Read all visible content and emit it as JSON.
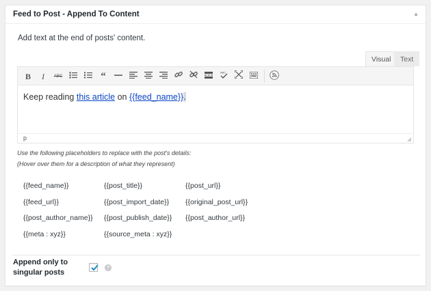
{
  "panel": {
    "title": "Feed to Post - Append To Content",
    "description": "Add text at the end of posts' content."
  },
  "editor": {
    "tabs": {
      "visual": "Visual",
      "text": "Text"
    },
    "toolbar_icons": [
      "bold-icon",
      "italic-icon",
      "strikethrough-icon",
      "bullet-list-icon",
      "numbered-list-icon",
      "blockquote-icon",
      "horizontal-rule-icon",
      "align-left-icon",
      "align-center-icon",
      "align-right-icon",
      "link-icon",
      "unlink-icon",
      "read-more-icon",
      "spellcheck-icon",
      "fullscreen-icon",
      "kitchen-sink-icon",
      "rss-icon"
    ],
    "content": {
      "prefix": "Keep reading ",
      "link1": "this article",
      "middle": " on ",
      "link2": "{{feed_name}}",
      "suffix": "."
    },
    "status_path": "p"
  },
  "help": {
    "line1": "Use the following placeholders to replace with the post's details:",
    "line2": "(Hover over them for a description of what they represent)"
  },
  "placeholders": [
    [
      "{{feed_name}}",
      "{{post_title}}",
      "{{post_url}}"
    ],
    [
      "{{feed_url}}",
      "{{post_import_date}}",
      "{{original_post_url}}"
    ],
    [
      "{{post_author_name}}",
      "{{post_publish_date}}",
      "{{post_author_url}}"
    ],
    [
      "{{meta : xyz}}",
      "{{source_meta : xyz}}",
      ""
    ]
  ],
  "option": {
    "label": "Append only to singular posts",
    "checked": true,
    "help_icon": "question-mark-icon"
  },
  "colors": {
    "link": "#0b44c6",
    "checkmark": "#1e8cbe"
  }
}
